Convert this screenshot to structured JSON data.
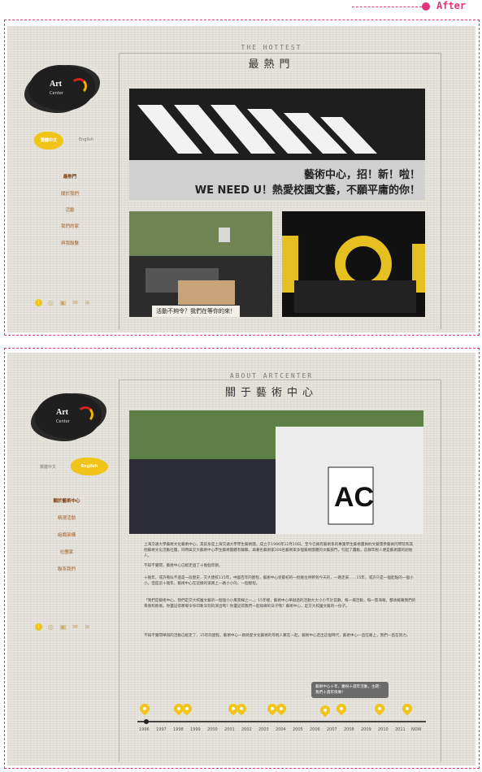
{
  "header": {
    "after_label": "After"
  },
  "brand": {
    "logo_text": "Art",
    "logo_sub": "Center"
  },
  "screen1": {
    "lang_active": "繁體中文",
    "lang_other": "English",
    "nav": [
      "最熱門",
      "關於我們",
      "活動",
      "我們的家",
      "與我聯繫"
    ],
    "section_en": "THE HOTTEST",
    "section_cn": "最熱門",
    "banner_line1": "藝術中心，招！新！啦！",
    "banner_line2": "WE NEED U！熱愛校園文藝，不願平庸的你！",
    "caption_left": "活動不夠令？我們在等你的來！"
  },
  "screen2": {
    "lang_active": "繁體中文",
    "lang_other": "English",
    "nav": [
      "關於藝術中心",
      "精選活動",
      "組織架構",
      "社團家",
      "聯系我們"
    ],
    "section_en": "ABOUT ARTCENTER",
    "section_cn": "關于藝術中心",
    "paragraphs": [
      "上海交通大學藝術文化藝術中心，其前身是上海交通大學學生藝術團，成立于1996年12月10日。至今已擁有藝術系的專業學生藝術團員約文藝獎參藝術的學院和其他藝術文化活動社團，同時與交大藝術中心學生藝術團體有聯繫，與著名藝術家300名藝術家多個藝術團體的文藝部門，引起了轟動，這群年輕人便是藝術團的創始人。",
      "不知不覺間，藝術中心已經走過了十幾個年頭。",
      "十幾年，或許看似不過是一段歷史，交大建校115年，中國百年的歷程，藝術中心從最初的一批幾位骨幹到今天的，一路走來……15年，或許只是一個起點的一個小小。但是這十幾年，藝術中心在這樣的道路上一路小小的、一個歷程。",
      "「我們是藝術中心，我們是交大校園文藝的一個個小小風景線之一。」15年裡，藝術中心舉辦過的活動大大小小不計其數。每一場活動，每一張海報，都承載著我們的青春和熱情。你還記得那場令你印象深刻的演出嗎？你還記得我們一起排練的日子嗎？藝術中心，是交大校園文藝的一份子。",
      "不知不覺間舉辦的活動已經走了，15年的歷程，藝術中心一群熱愛文化藝術的年輕人聚在一起，藝術中心走出這個時代，藝術中心一直在路上，我們一直在努力。"
    ],
    "tooltip": "藝術中心十年，慶祝十週年活動，主題：我們十週年快樂！",
    "years": [
      "1996",
      "1997",
      "1998",
      "1999",
      "2000",
      "2001",
      "2002",
      "2003",
      "2004",
      "2005",
      "2006",
      "2007",
      "2008",
      "2009",
      "2010",
      "2011",
      "NOW"
    ]
  },
  "colors": {
    "accent": "#f0c419",
    "dash": "#e0357a"
  }
}
